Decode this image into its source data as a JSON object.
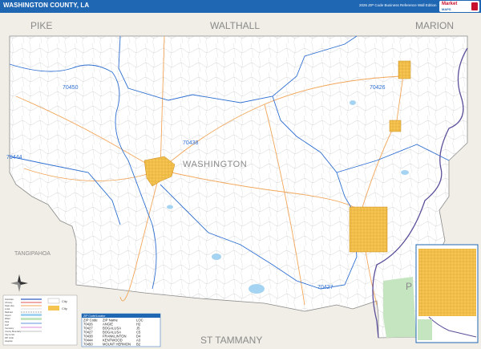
{
  "header": {
    "title": "WASHINGTON COUNTY, LA",
    "edition": "2026 ZIP Code Business Reference Wall Edition",
    "logo_main": "Market",
    "logo_sub": "MAPS"
  },
  "map": {
    "county_name": "WASHINGTON",
    "neighbors": {
      "north_west": "PIKE",
      "north_center": "WALTHALL",
      "north_east": "MARION",
      "west": "TANGIPAHOA",
      "south": "ST TAMMANY",
      "east_partial": "P"
    },
    "zip_labels": [
      "70450",
      "70426",
      "70438",
      "70444",
      "70427"
    ]
  },
  "legend": {
    "rows": [
      "Interstate",
      "US Hwy",
      "State Hwy",
      "Local",
      "Railroad",
      "Airport",
      "Water",
      "Park",
      "Golf",
      "Cemetery",
      "County Boundary",
      "City Limits",
      "ZIP Code",
      "Hospital"
    ],
    "symbols": [
      "City",
      "City"
    ]
  },
  "zip_index": {
    "title": "ZIP Code/Locator",
    "headers": [
      "ZIP Code",
      "ZIP Name",
      "LOC"
    ],
    "rows": [
      [
        "70426",
        "ANGIE",
        "H2"
      ],
      [
        "70427",
        "BOGALUSA",
        "J5"
      ],
      [
        "70427",
        "BOGALUSA",
        "C5"
      ],
      [
        "70438",
        "FRANKLINTON",
        "D4"
      ],
      [
        "70444",
        "KENTWOOD",
        "A3"
      ],
      [
        "70450",
        "MOUNT HERMON",
        "B2"
      ]
    ]
  },
  "colors": {
    "header": "#1f66b3",
    "city": "#f5c451",
    "zip_boundary": "#2e6fd1",
    "river": "#5b4f9a",
    "neighbor": "#f0eee6",
    "park": "#c5e4c0",
    "water": "#a5d3f2"
  }
}
